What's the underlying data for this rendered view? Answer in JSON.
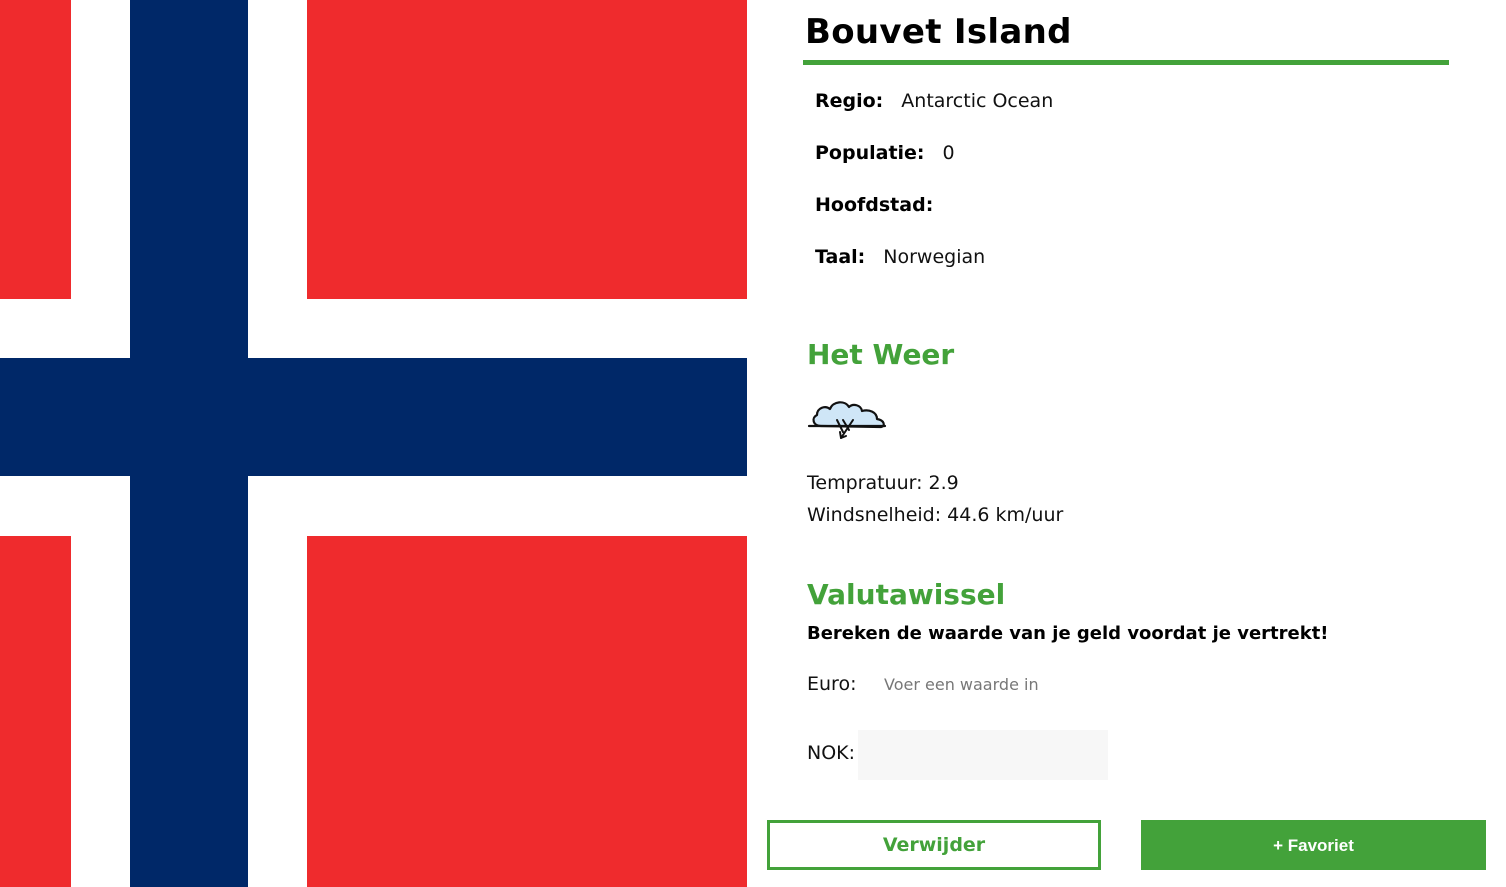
{
  "country": {
    "name": "Bouvet Island",
    "flag": {
      "country": "Norway",
      "colors": {
        "red": "#ef2b2d",
        "white": "#ffffff",
        "blue": "#002868"
      }
    }
  },
  "info": {
    "region_label": "Regio:",
    "region_value": "Antarctic Ocean",
    "population_label": "Populatie:",
    "population_value": "0",
    "capital_label": "Hoofdstad:",
    "capital_value": "",
    "language_label": "Taal:",
    "language_value": "Norwegian"
  },
  "weather": {
    "heading": "Het Weer",
    "icon": "cloud-hail-icon",
    "temperature_text": "Tempratuur: 2.9",
    "wind_text": "Windsnelheid: 44.6 km/uur"
  },
  "currency": {
    "heading": "Valutawissel",
    "subtitle": "Bereken de waarde van je geld voordat je vertrekt!",
    "euro_label": "Euro:",
    "euro_placeholder": "Voer een waarde in",
    "target_label": "NOK:",
    "target_value": ""
  },
  "actions": {
    "remove_label": "Verwijder",
    "favorite_label": "+ Favoriet"
  },
  "theme": {
    "accent": "#43a23a"
  }
}
